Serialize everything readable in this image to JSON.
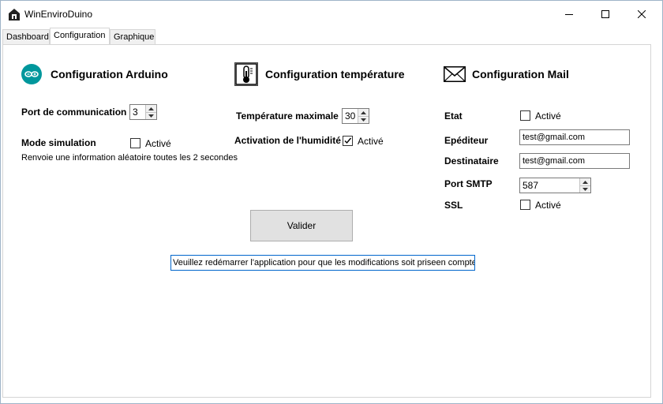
{
  "window": {
    "title": "WinEnviroDuino"
  },
  "tabs": [
    {
      "label": "Dashboard"
    },
    {
      "label": "Configuration"
    },
    {
      "label": "Graphique"
    }
  ],
  "arduino": {
    "title": "Configuration Arduino",
    "port_label": "Port de communication",
    "port_value": "3",
    "simulation_label": "Mode simulation",
    "simulation_check_label": "Activé",
    "simulation_checked": false,
    "simulation_info": "Renvoie une information aléatoire toutes les 2 secondes"
  },
  "temperature": {
    "title": "Configuration température",
    "max_label": "Température maximale",
    "max_value": "30",
    "humidity_label": "Activation de l'humidité",
    "humidity_check_label": "Activé",
    "humidity_checked": true
  },
  "mail": {
    "title": "Configuration Mail",
    "etat_label": "Etat",
    "etat_check_label": "Activé",
    "etat_checked": false,
    "sender_label": "Epéditeur",
    "sender_value": "test@gmail.com",
    "recipient_label": "Destinataire",
    "recipient_value": "test@gmail.com",
    "smtp_label": "Port SMTP",
    "smtp_value": "587",
    "ssl_label": "SSL",
    "ssl_check_label": "Activé",
    "ssl_checked": false
  },
  "actions": {
    "submit_label": "Valider"
  },
  "notice": "Veuillez redémarrer l'application pour que les modifications soit priseen compte",
  "colors": {
    "arduino_icon": "#00979c",
    "notice_border": "#0066cc",
    "button_bg": "#e1e1e1"
  }
}
